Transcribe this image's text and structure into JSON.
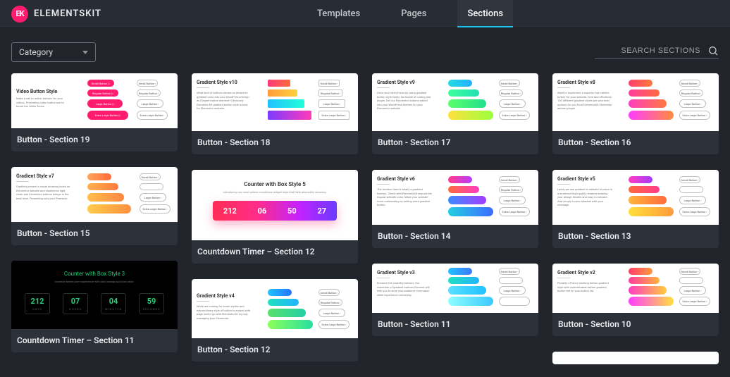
{
  "brand": {
    "logo_text": "EK",
    "name": "ELEMENTSKIT"
  },
  "tabs": {
    "templates": "Templates",
    "pages": "Pages",
    "sections": "Sections"
  },
  "filter": {
    "category": "Category"
  },
  "search": {
    "placeholder": "SEARCH SECTIONS"
  },
  "outline_buttons": {
    "b0": "Small Button ›",
    "b1": "Regular Button ›",
    "b2": "Large Button ›",
    "b3": "Extra Large Button ›"
  },
  "cards": {
    "s19": {
      "title": "Button - Section 19",
      "head": "Video Button Style",
      "para": "Make a call to action buttons for your videos. Presenting video button use to boost the visitor focus.",
      "p0": "Small Button ▷",
      "p1": "Regular Button ▷",
      "p2": "Large Button ▷",
      "p3": "Extra Large Button ▷"
    },
    "s18": {
      "title": "Button - Section 18",
      "head": "Gradient Style v10",
      "para": "What kind of buttons shows an attractive gradient color into your WordPress Design as Elegant button element? Obviously Elements Kit gradient button style is best for Elementor website."
    },
    "s17": {
      "title": "Button - Section 17",
      "head": "Gradient Style v9",
      "para": "Grow your site's focus by using gradient button style easily. No hustle of coding and plugin. Get our Elementor Addons added into your WordPress themes for your Elementor website."
    },
    "s16": {
      "title": "Button - Section 16",
      "head": "Gradient Style v8",
      "para": "Want to implement a superior eye catcher button for your website. Free and effortless 100 different gradient styles are your best options for you from ElementsKit Elementor addons plugin."
    },
    "s15": {
      "title": "Button - Section 15",
      "head": "Gradient Style v7",
      "para": "Gradient present a visual amazing looks on Elementor website and experience light clean and Elementor Addons design is the best level. Presenting only your Premium."
    },
    "s12t": {
      "title": "Countdown Timer – Section 12",
      "head": "Counter with Box Style 5",
      "sub": "Introducing our most potent countdown widget style that feels absolutely stunning.",
      "n0": "212",
      "n1": "06",
      "n2": "50",
      "n3": "27"
    },
    "s14": {
      "title": "Button - Section 14",
      "head": "Gradient Style v6",
      "para": "The modern time is totally a gradient fashion. Check with ElementsKit beyond the regular website color. Make your website more outstanding by setting extra gradient button."
    },
    "s13": {
      "title": "Button - Section 13",
      "head": "Gradient Style v5",
      "para": "Lately we use gradient in website to place in a dominant high quality shadow keeping your design flexible and easy to execute. Add simply a color shadow with your message."
    },
    "s11t": {
      "title": "Countdown Timer – Section 11",
      "head": "Counter with Box Style 3",
      "sub": "Increase better user experience with dark background box style.",
      "n0": "212",
      "l0": "DAYS",
      "n1": "07",
      "l1": "HOURS",
      "n2": "04",
      "l2": "MINUTES",
      "n3": "59",
      "l3": "SECONDS"
    },
    "s12": {
      "title": "Button - Section 12",
      "head": "Gradient Style v4",
      "para": "While are looking for some stylish and extraordinary style of button to embed with page sector go with Elements Kit, by only managing your Elementor."
    },
    "s11": {
      "title": "Button - Section 11",
      "head": "Gradient Style v3",
      "para": "Enhance the usability buttons. Our collection of gradient buttons Element will help you to wow your audience command while experience conveying."
    },
    "s10": {
      "title": "Button - Section 10",
      "head": "Gradient Style v2",
      "para": "Plurality of fancy working button gradient style with customizable button gradient button are on your button list."
    }
  }
}
